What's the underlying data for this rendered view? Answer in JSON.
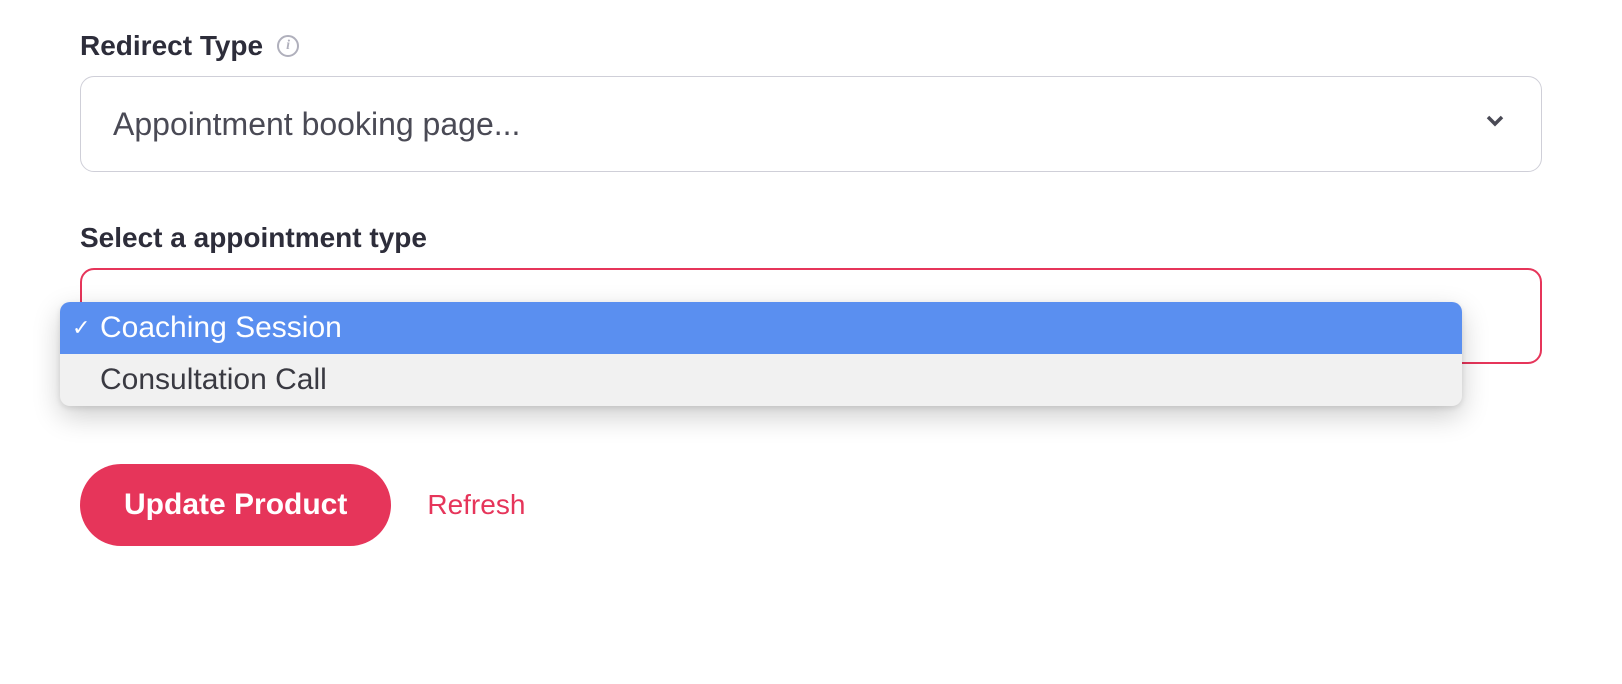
{
  "redirect_type": {
    "label": "Redirect Type",
    "selected_value": "Appointment booking page..."
  },
  "appointment_type": {
    "label": "Select a appointment type",
    "options": [
      {
        "label": "Coaching Session",
        "selected": true
      },
      {
        "label": "Consultation Call",
        "selected": false
      }
    ]
  },
  "actions": {
    "update_label": "Update Product",
    "refresh_label": "Refresh"
  }
}
